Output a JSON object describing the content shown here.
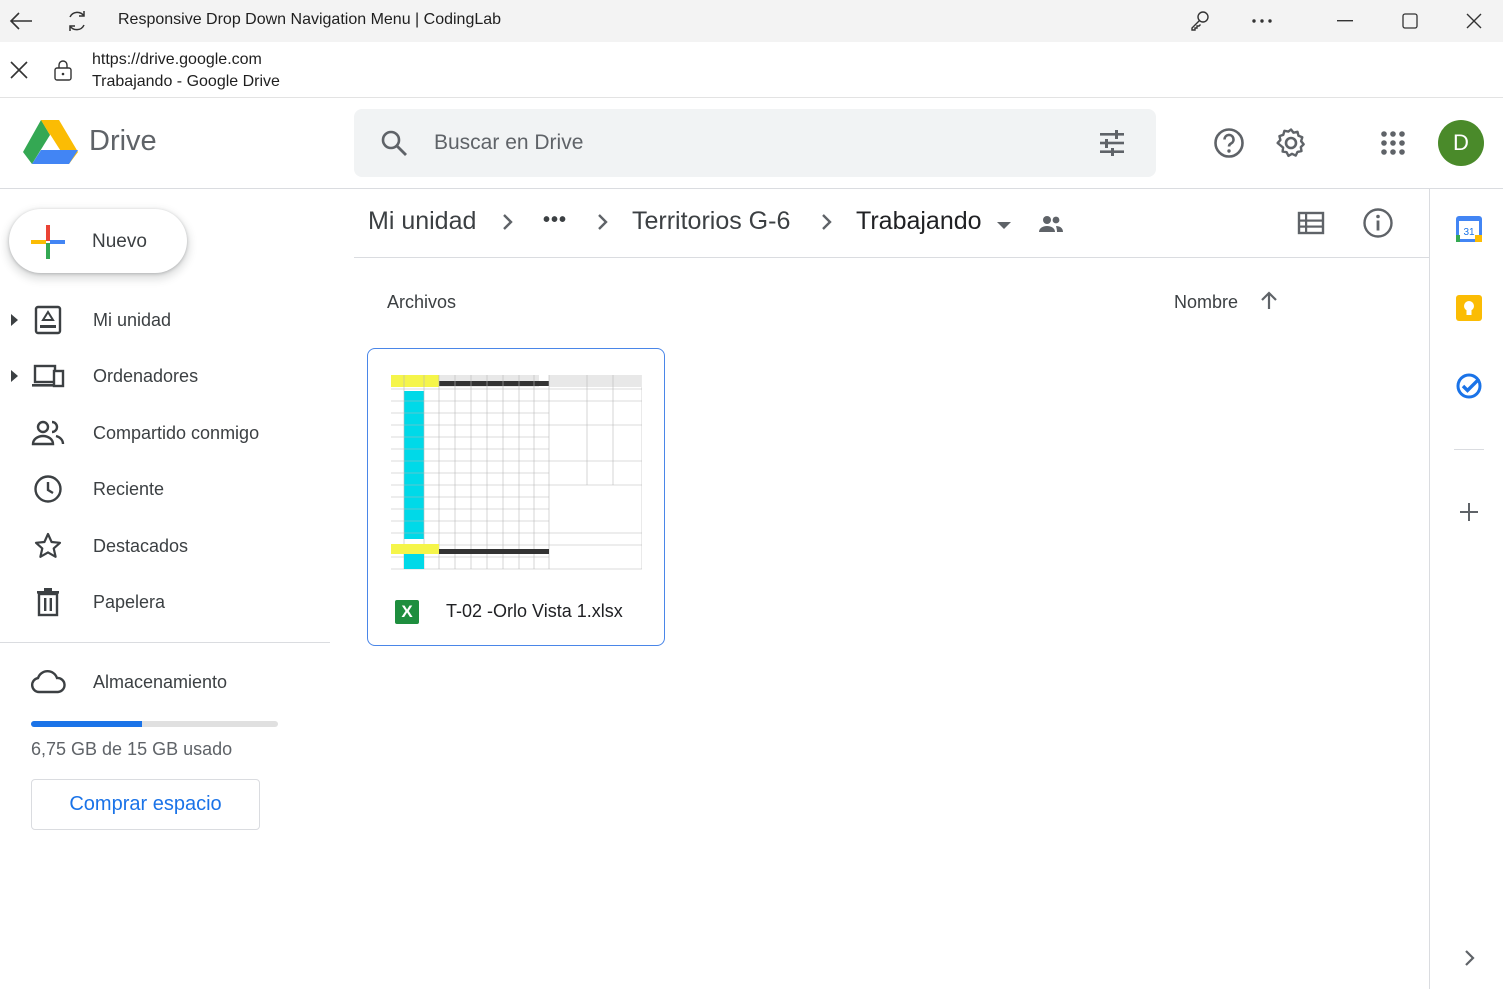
{
  "window": {
    "title": "Responsive Drop Down Navigation Menu | CodingLab"
  },
  "address": {
    "url": "https://drive.google.com",
    "page_title": "Trabajando - Google Drive"
  },
  "header": {
    "brand": "Drive",
    "search_placeholder": "Buscar en Drive",
    "avatar_letter": "D"
  },
  "sidebar": {
    "new_label": "Nuevo",
    "items": [
      {
        "label": "Mi unidad"
      },
      {
        "label": "Ordenadores"
      },
      {
        "label": "Compartido conmigo"
      },
      {
        "label": "Reciente"
      },
      {
        "label": "Destacados"
      },
      {
        "label": "Papelera"
      },
      {
        "label": "Almacenamiento"
      }
    ],
    "storage": {
      "used_fraction": 0.45,
      "text": "6,75 GB de 15 GB usado",
      "buy_label": "Comprar espacio"
    }
  },
  "breadcrumb": {
    "root": "Mi unidad",
    "more": "•••",
    "parent": "Territorios G-6",
    "current": "Trabajando"
  },
  "main": {
    "section_label": "Archivos",
    "sort_label": "Nombre",
    "files": [
      {
        "name": "T-02 -Orlo Vista 1.xlsx",
        "type_badge": "X"
      }
    ]
  },
  "side_panel": {
    "calendar_day": "31"
  },
  "colors": {
    "accent": "#1a73e8",
    "avatar": "#4a8a2a",
    "excel": "#1e8e3e"
  }
}
